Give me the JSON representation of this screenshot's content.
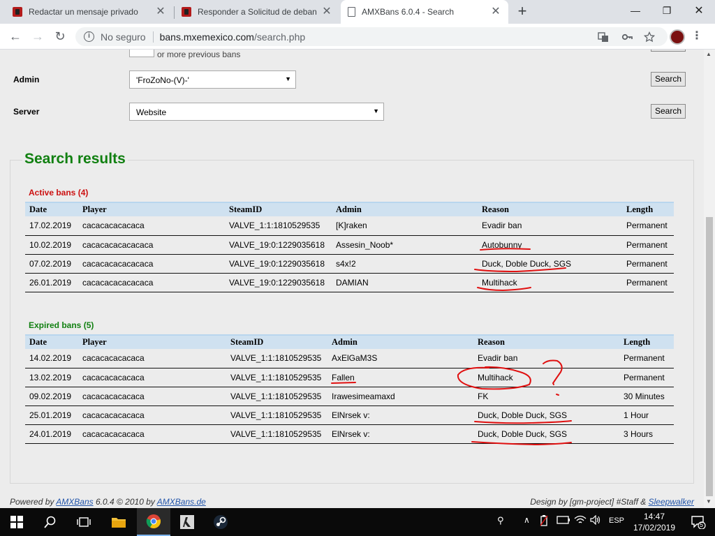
{
  "browser": {
    "tabs": [
      {
        "title": "Redactar un mensaje privado",
        "active": false
      },
      {
        "title": "Responder a Solicitud de debane",
        "active": false
      },
      {
        "title": "AMXBans 6.0.4 - Search",
        "active": true
      }
    ],
    "close_glyph": "✕",
    "new_tab_glyph": "+",
    "window": {
      "minimize": "—",
      "maximize": "❐",
      "close": "✕"
    },
    "nav": {
      "back": "←",
      "forward": "→",
      "reload": "↻"
    },
    "security_label": "No seguro",
    "url_host": "bans.mxemexico.com",
    "url_path": "/search.php"
  },
  "form": {
    "players_partial": "or more previous bans",
    "admin_label": "Admin",
    "admin_value": "'FroZoNo-(V)-'",
    "server_label": "Server",
    "server_value": "Website",
    "search_button": "Search"
  },
  "results": {
    "title": "Search results",
    "active": {
      "title": "Active bans (4)",
      "title_color": "#cc1111",
      "columns": [
        "Date",
        "Player",
        "SteamID",
        "Admin",
        "Reason",
        "Length"
      ],
      "rows": [
        [
          "17.02.2019",
          "cacacacacacaca",
          "VALVE_1:1:1810529535",
          "[K]raken",
          "Evadir ban",
          "Permanent"
        ],
        [
          "10.02.2019",
          "cacacacacacacaca",
          "VALVE_19:0:1229035618",
          "Assesin_Noob*",
          "Autobunny",
          "Permanent"
        ],
        [
          "07.02.2019",
          "cacacacacacacaca",
          "VALVE_19:0:1229035618",
          "s4x!2",
          "Duck, Doble Duck, SGS",
          "Permanent"
        ],
        [
          "26.01.2019",
          "cacacacacacacaca",
          "VALVE_19:0:1229035618",
          "DAMIAN",
          "Multihack",
          "Permanent"
        ]
      ]
    },
    "expired": {
      "title": "Expired bans (5)",
      "title_color": "#118011",
      "columns": [
        "Date",
        "Player",
        "SteamID",
        "Admin",
        "Reason",
        "Length"
      ],
      "rows": [
        [
          "14.02.2019",
          "cacacacacacaca",
          "VALVE_1:1:1810529535",
          "AxElGaM3S",
          "Evadir ban",
          "Permanent"
        ],
        [
          "13.02.2019",
          "cacacacacacaca",
          "VALVE_1:1:1810529535",
          "Fallen",
          "Multihack",
          "Permanent"
        ],
        [
          "09.02.2019",
          "cacacacacacaca",
          "VALVE_1:1:1810529535",
          "Irawesimeamaxd",
          "FK",
          "30 Minutes"
        ],
        [
          "25.01.2019",
          "cacacacacacaca",
          "VALVE_1:1:1810529535",
          "ElNrsek v:",
          "Duck, Doble Duck, SGS",
          "1 Hour"
        ],
        [
          "24.01.2019",
          "cacacacacacaca",
          "VALVE_1:1:1810529535",
          "ElNrsek v:",
          "Duck, Doble Duck, SGS",
          "3 Hours"
        ]
      ]
    }
  },
  "footer": {
    "powered_prefix": "Powered by",
    "amxbans_link": "AMXBans",
    "version_text": "6.0.4 © 2010 by",
    "amxbans_site": "AMXBans.de",
    "design_text": "Design by [gm-project] #Staff &",
    "sleepwalker_link": "Sleepwalker"
  },
  "taskbar": {
    "language": "ESP",
    "time": "14:47",
    "date": "17/02/2019",
    "notifications": "5"
  },
  "colors": {
    "accent_green": "#118011",
    "annotation_red": "#e01010",
    "table_header": "#cfe1f0"
  }
}
